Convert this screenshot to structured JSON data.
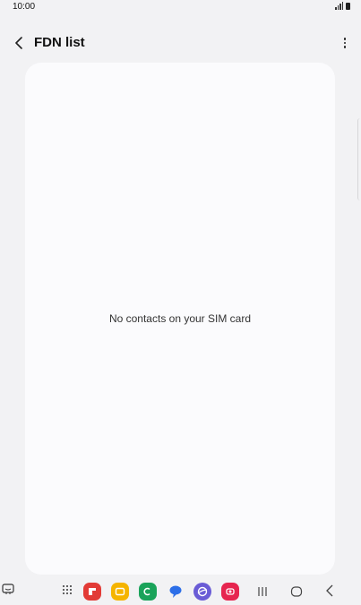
{
  "status_bar": {
    "time": "10:00"
  },
  "header": {
    "title": "FDN list",
    "back_icon": "chevron-left-icon",
    "more_icon": "more-vertical-icon"
  },
  "content": {
    "empty_message": "No contacts on your SIM card"
  },
  "nav_bar": {
    "apps": [
      {
        "name": "flipboard",
        "color": "#e23b36"
      },
      {
        "name": "my-files",
        "color": "#f5b400"
      },
      {
        "name": "phone",
        "color": "#1aa35a"
      },
      {
        "name": "messages",
        "color": "#2c6ee8"
      },
      {
        "name": "internet",
        "color": "#6a5cd6"
      },
      {
        "name": "screen-recorder",
        "color": "#e6254f"
      }
    ]
  }
}
